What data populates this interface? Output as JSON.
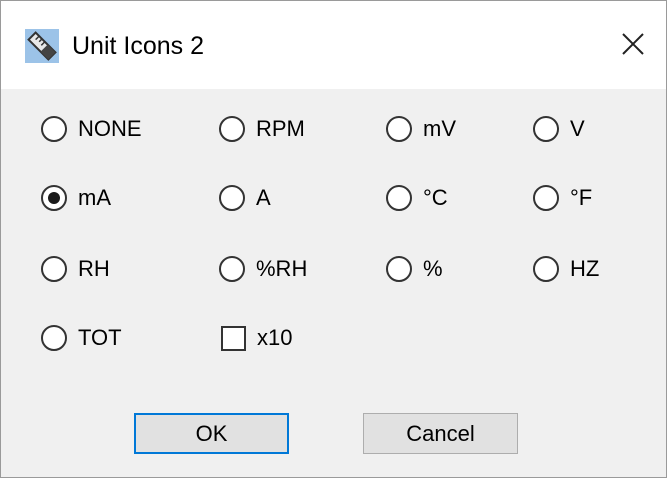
{
  "window": {
    "title": "Unit Icons 2"
  },
  "options": [
    {
      "label": "NONE",
      "type": "radio",
      "checked": false
    },
    {
      "label": "RPM",
      "type": "radio",
      "checked": false
    },
    {
      "label": "mV",
      "type": "radio",
      "checked": false
    },
    {
      "label": "V",
      "type": "radio",
      "checked": false
    },
    {
      "label": "mA",
      "type": "radio",
      "checked": true
    },
    {
      "label": "A",
      "type": "radio",
      "checked": false
    },
    {
      "label": "°C",
      "type": "radio",
      "checked": false
    },
    {
      "label": "°F",
      "type": "radio",
      "checked": false
    },
    {
      "label": "RH",
      "type": "radio",
      "checked": false
    },
    {
      "label": "%RH",
      "type": "radio",
      "checked": false
    },
    {
      "label": "%",
      "type": "radio",
      "checked": false
    },
    {
      "label": "HZ",
      "type": "radio",
      "checked": false
    },
    {
      "label": "TOT",
      "type": "radio",
      "checked": false
    },
    {
      "label": "x10",
      "type": "checkbox",
      "checked": false
    }
  ],
  "buttons": {
    "ok": "OK",
    "cancel": "Cancel"
  },
  "colors": {
    "focus_border": "#0078d7",
    "dialog_bg": "#f0f0f0",
    "button_bg": "#e1e1e1"
  },
  "icons": {
    "app": "ruler-icon",
    "close": "close-icon"
  }
}
